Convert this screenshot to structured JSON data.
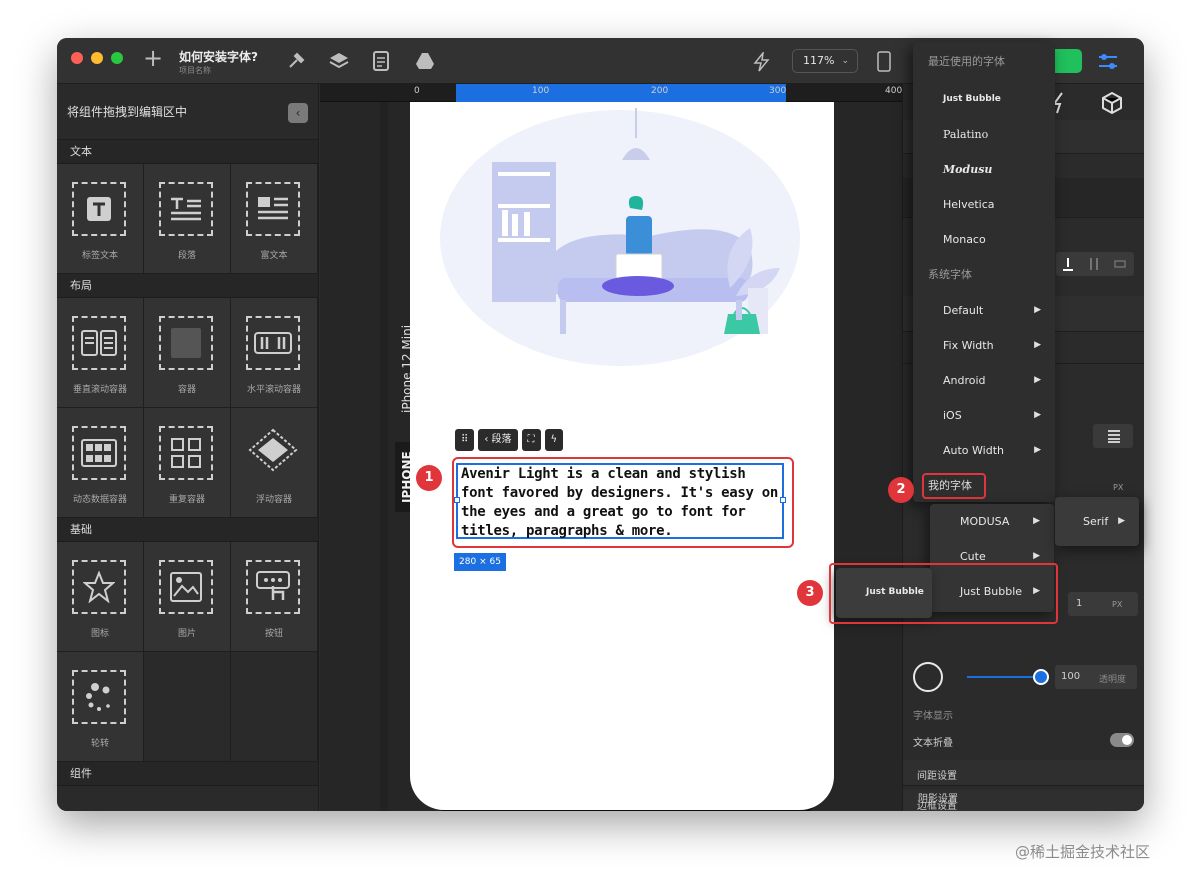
{
  "app": {
    "title": "如何安装字体?",
    "subtitle": "项目名称",
    "zoom": "117%",
    "zoom_chevron": "⌄"
  },
  "left_panel": {
    "header": "将组件拖拽到编辑区中",
    "collapse_glyph": "‹",
    "sections": [
      {
        "title": "文本",
        "items": [
          "标签文本",
          "段落",
          "富文本"
        ]
      },
      {
        "title": "布局",
        "items": [
          "垂直滚动容器",
          "容器",
          "水平滚动容器",
          "动态数据容器",
          "重复容器",
          "浮动容器"
        ]
      },
      {
        "title": "基础",
        "items": [
          "图标",
          "图片",
          "按钮",
          "轮转"
        ]
      },
      {
        "title": "组件",
        "items": []
      }
    ]
  },
  "canvas": {
    "ruler_numbers": [
      "0",
      "100",
      "200",
      "300",
      "400"
    ],
    "device_label": "iPhone 12 Mini",
    "device_tab": "IPHONE",
    "toolbar": {
      "drag_glyph": "⠿",
      "back_label": "‹ 段落",
      "fit_glyph": "⛶",
      "action_glyph": "ϟ"
    },
    "text_content": "Avenir Light is a clean and stylish font favored by designers. It's easy on the eyes and a great go to font for titles, paragraphs & more.",
    "size_tag": "280 × 65"
  },
  "badges": [
    "1",
    "2",
    "3"
  ],
  "right_panel": {
    "unit_px": "PX",
    "line_value": "1",
    "opacity_value": "100",
    "opacity_label": "透明度",
    "font_display": "字体显示",
    "text_fold": "文本折叠",
    "spacing": "间距设置",
    "border": "边框设置",
    "shadow": "阴影设置"
  },
  "font_menu": {
    "recent_title": "最近使用的字体",
    "recent": [
      "Just Bubble",
      "Palatino",
      "Modusu",
      "Helvetica",
      "Monaco"
    ],
    "system_title": "系统字体",
    "system": [
      "Default",
      "Fix Width",
      "Android",
      "iOS",
      "Auto Width"
    ],
    "my_fonts_title": "我的字体",
    "my_fonts": [
      "MODUSA",
      "Cute",
      "Just Bubble"
    ],
    "submenu_serif": "Serif",
    "preview_just_bubble": "Just Bubble",
    "arrow_glyph": "▶"
  },
  "watermark": "@稀土掘金技术社区",
  "colors": {
    "accent_blue": "#1c6fe0",
    "highlight_red": "#e0353b",
    "publish_green": "#20c05c"
  }
}
